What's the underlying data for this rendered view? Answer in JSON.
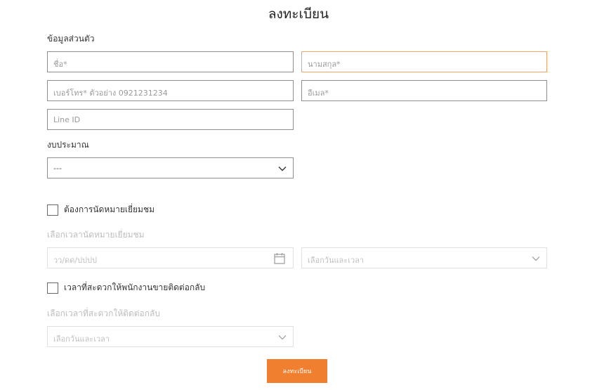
{
  "form": {
    "title": "ลงทะเบียน",
    "personal_section_label": "ข้อมูลส่วนตัว",
    "first_name_placeholder": "ชื่อ*",
    "last_name_placeholder": "นามสกุล*",
    "phone_placeholder": "เบอร์โทร* ตัวอย่าง 0921231234",
    "email_placeholder": "อีเมล*",
    "line_id_placeholder": "Line ID",
    "budget_label": "งบประมาณ",
    "budget_selected": "---",
    "appointment_checkbox_label": "ต้องการนัดหมายเยี่ยมชม",
    "appointment_time_label": "เลือกเวลานัดหมายเยี่ยมชม",
    "date_placeholder": "วว/ดด/ปปปป",
    "datetime_select_placeholder": "เลือกวันและเวลา",
    "contact_checkbox_label": "เวลาที่สะดวกให้พนักงานขายติดต่อกลับ",
    "contact_time_label": "เลือกเวลาที่สะดวกให้ติดต่อกลับ",
    "contact_select_placeholder": "เลือกวันและเวลา",
    "submit_label": "ลงทะเบียน"
  },
  "icons": {
    "dropdown": "chevron-down-icon",
    "calendar": "calendar-icon"
  },
  "colors": {
    "accent": "#f07f2f",
    "focus_border": "#f4a36b",
    "border": "#8e8e8e",
    "disabled_border": "#e0e0e0"
  }
}
